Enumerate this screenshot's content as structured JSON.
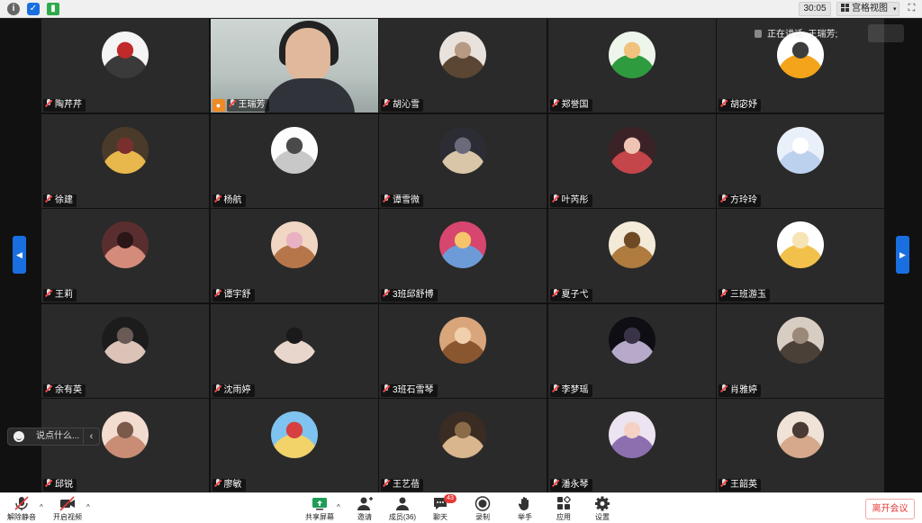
{
  "topbar": {
    "timer": "30:05",
    "view_mode": "宫格视图"
  },
  "stage": {
    "speaking_label": "正在讲话: 王瑞芳;",
    "chat_placeholder": "说点什么..."
  },
  "participants": [
    {
      "name": "陶芹芹",
      "avatar_colors": [
        "#f4f4f4",
        "#3a3a3a",
        "#c02a2a"
      ]
    },
    {
      "name": "王瑞芳",
      "video": true
    },
    {
      "name": "胡沁雪",
      "avatar_colors": [
        "#e9e2dc",
        "#5b4634",
        "#b79a84"
      ]
    },
    {
      "name": "郑誉国",
      "avatar_colors": [
        "#eef5ea",
        "#2e9b3e",
        "#f1c27d"
      ]
    },
    {
      "name": "胡宓妤",
      "avatar_colors": [
        "#ffffff",
        "#f3a41b",
        "#3d3d3d"
      ]
    },
    {
      "name": "徐建",
      "avatar_colors": [
        "#4a3a2a",
        "#e8b84c",
        "#7a2f2f"
      ]
    },
    {
      "name": "杨航",
      "avatar_colors": [
        "#fdfdfd",
        "#c8c8c8",
        "#4a4a4a"
      ]
    },
    {
      "name": "谭雪微",
      "avatar_colors": [
        "#2c2c34",
        "#d9c5a8",
        "#6a6a7a"
      ]
    },
    {
      "name": "叶芮彤",
      "avatar_colors": [
        "#3a2226",
        "#c4454a",
        "#efc4b4"
      ]
    },
    {
      "name": "方玲玲",
      "avatar_colors": [
        "#e9f0fa",
        "#bcd1ee",
        "#ffffff"
      ]
    },
    {
      "name": "王莉",
      "avatar_colors": [
        "#5a2e2e",
        "#d58b7a",
        "#2a1616"
      ]
    },
    {
      "name": "谭宇舒",
      "avatar_colors": [
        "#f1d6c4",
        "#b7764a",
        "#e9b2c3"
      ]
    },
    {
      "name": "3班邱舒博",
      "avatar_colors": [
        "#d6466f",
        "#6d9bd8",
        "#f6c46a"
      ]
    },
    {
      "name": "夏子弋",
      "avatar_colors": [
        "#f4ead8",
        "#b07b3e",
        "#6e4a24"
      ]
    },
    {
      "name": "三班游玉",
      "avatar_colors": [
        "#ffffff",
        "#f2c14b",
        "#f7e4b5"
      ]
    },
    {
      "name": "余有英",
      "avatar_colors": [
        "#1c1c1c",
        "#dcc3b8",
        "#6a5a56"
      ]
    },
    {
      "name": "沈雨婷",
      "avatar_colors": [
        "#2a2a2a",
        "#e8d6cc",
        "#1a1a1a"
      ]
    },
    {
      "name": "3班石雪琴",
      "avatar_colors": [
        "#d9a57a",
        "#8a5630",
        "#f0d0ac"
      ]
    },
    {
      "name": "李梦瑶",
      "avatar_colors": [
        "#0e0e14",
        "#b7a9c9",
        "#3a3348"
      ]
    },
    {
      "name": "肖雅婷",
      "avatar_colors": [
        "#d8cdc2",
        "#4a4038",
        "#9a8878"
      ]
    },
    {
      "name": "邱锐",
      "avatar_colors": [
        "#f2dccf",
        "#c88d74",
        "#7a5a4a"
      ]
    },
    {
      "name": "廖敏",
      "avatar_colors": [
        "#7fc3f0",
        "#f1d36a",
        "#d64040"
      ]
    },
    {
      "name": "王艺蓓",
      "avatar_colors": [
        "#3a2c22",
        "#d9b68d",
        "#8a6a48"
      ]
    },
    {
      "name": "潘永琴",
      "avatar_colors": [
        "#ede4f1",
        "#8d6fb0",
        "#f4d1c4"
      ]
    },
    {
      "name": "王韶英",
      "avatar_colors": [
        "#efe2d6",
        "#d6a98c",
        "#4a3a34"
      ]
    }
  ],
  "toolbar": {
    "unmute": "解除静音",
    "start_video": "开启视频",
    "share_screen": "共享屏幕",
    "invite": "邀请",
    "members": "成员(36)",
    "chat": "聊天",
    "chat_badge": "43",
    "record": "录制",
    "raise_hand": "举手",
    "apps": "应用",
    "settings": "设置",
    "leave": "离开会议"
  },
  "colors": {
    "accent_blue": "#1a6fe0",
    "host_orange": "#f08a24",
    "leave_red": "#e53935"
  }
}
